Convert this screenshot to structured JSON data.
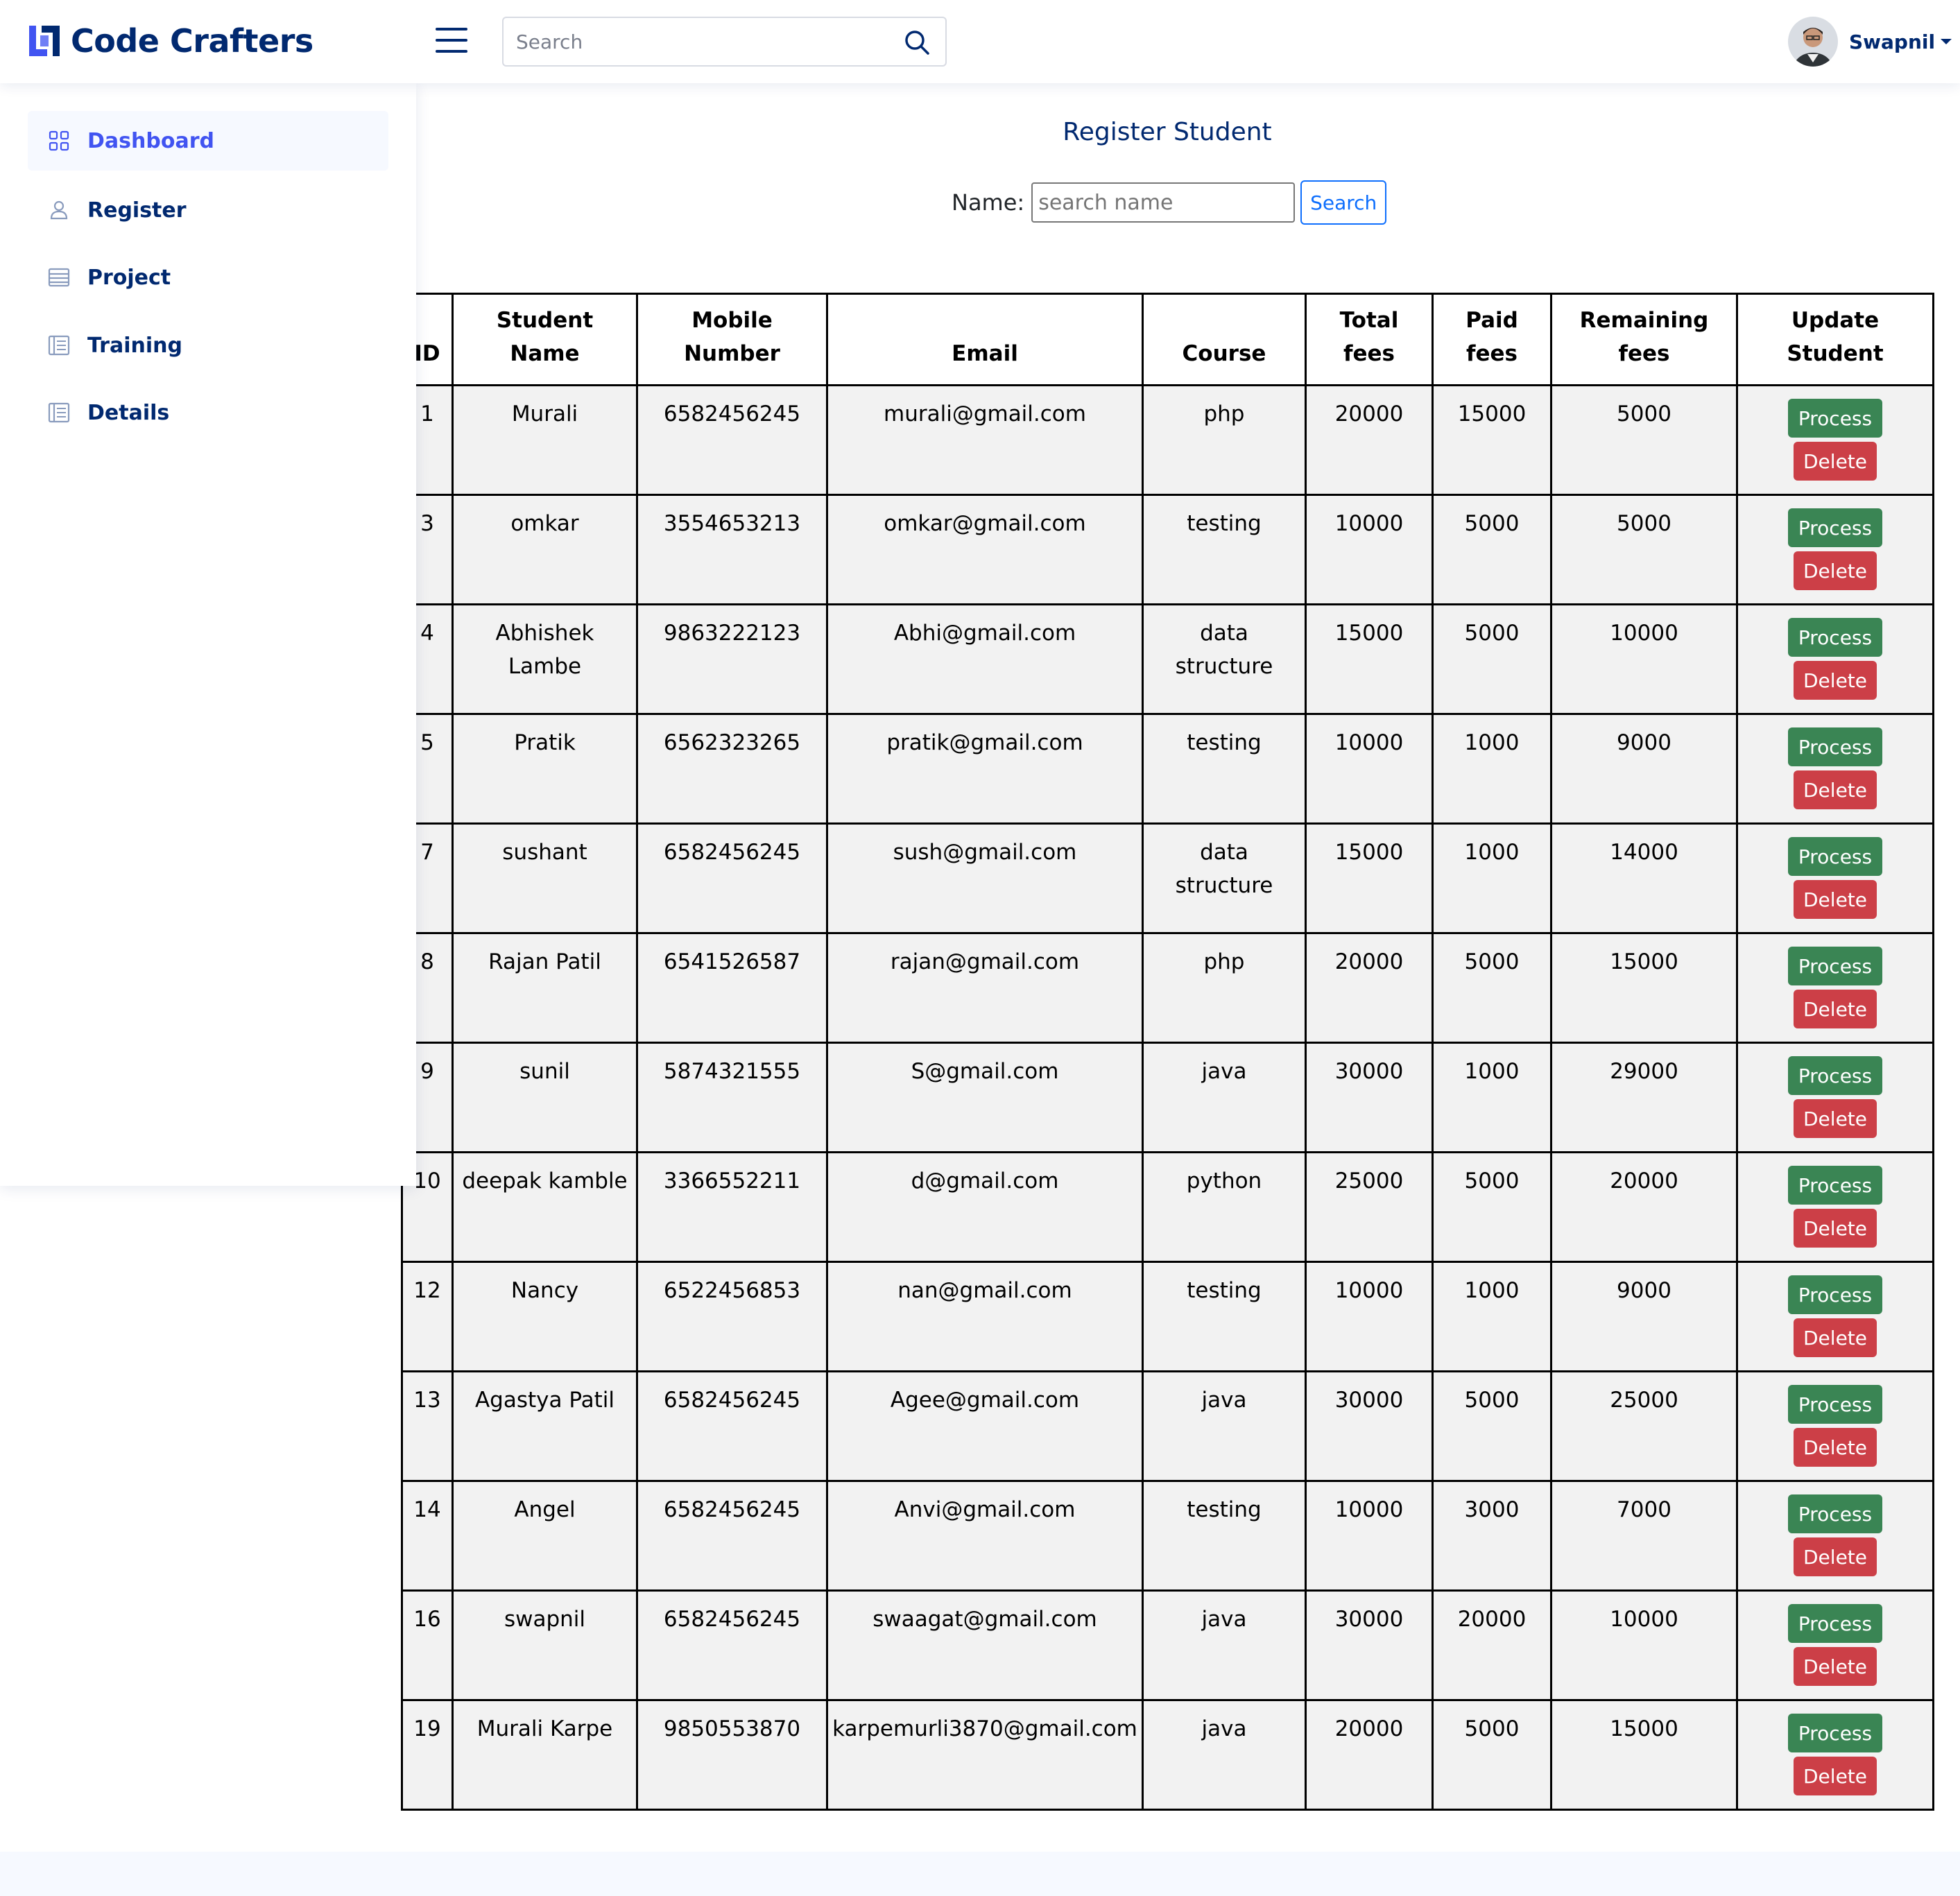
{
  "header": {
    "brand": "Code Crafters",
    "search_placeholder": "Search",
    "user_name": "Swapnil",
    "icons": {
      "logo": "logo-icon",
      "menu": "hamburger-icon",
      "search": "search-icon",
      "caret": "caret-down-icon"
    }
  },
  "sidebar": {
    "items": [
      {
        "label": "Dashboard",
        "icon": "grid-icon",
        "active": true
      },
      {
        "label": "Register",
        "icon": "person-icon",
        "active": false
      },
      {
        "label": "Project",
        "icon": "layout-icon",
        "active": false
      },
      {
        "label": "Training",
        "icon": "table-icon",
        "active": false
      },
      {
        "label": "Details",
        "icon": "table-icon",
        "active": false
      }
    ]
  },
  "main": {
    "title": "Register Student",
    "filter": {
      "label": "Name:",
      "placeholder": "search name",
      "button": "Search"
    },
    "table": {
      "headers": {
        "id": "ID",
        "name": "Student Name",
        "mobile": "Mobile Number",
        "email": "Email",
        "course": "Course",
        "total": "Total fees",
        "paid": "Paid fees",
        "remaining": "Remaining fees",
        "update": "Update Student"
      },
      "process_label": "Process",
      "delete_label": "Delete",
      "rows": [
        {
          "id": "1",
          "name": "Murali",
          "mobile": "6582456245",
          "email": "murali@gmail.com",
          "course": "php",
          "total": "20000",
          "paid": "15000",
          "remaining": "5000"
        },
        {
          "id": "3",
          "name": "omkar",
          "mobile": "3554653213",
          "email": "omkar@gmail.com",
          "course": "testing",
          "total": "10000",
          "paid": "5000",
          "remaining": "5000"
        },
        {
          "id": "4",
          "name": "Abhishek Lambe",
          "mobile": "9863222123",
          "email": "Abhi@gmail.com",
          "course": "data structure",
          "total": "15000",
          "paid": "5000",
          "remaining": "10000"
        },
        {
          "id": "5",
          "name": "Pratik",
          "mobile": "6562323265",
          "email": "pratik@gmail.com",
          "course": "testing",
          "total": "10000",
          "paid": "1000",
          "remaining": "9000"
        },
        {
          "id": "7",
          "name": "sushant",
          "mobile": "6582456245",
          "email": "sush@gmail.com",
          "course": "data structure",
          "total": "15000",
          "paid": "1000",
          "remaining": "14000"
        },
        {
          "id": "8",
          "name": "Rajan Patil",
          "mobile": "6541526587",
          "email": "rajan@gmail.com",
          "course": "php",
          "total": "20000",
          "paid": "5000",
          "remaining": "15000"
        },
        {
          "id": "9",
          "name": "sunil",
          "mobile": "5874321555",
          "email": "S@gmail.com",
          "course": "java",
          "total": "30000",
          "paid": "1000",
          "remaining": "29000"
        },
        {
          "id": "10",
          "name": "deepak kamble",
          "mobile": "3366552211",
          "email": "d@gmail.com",
          "course": "python",
          "total": "25000",
          "paid": "5000",
          "remaining": "20000"
        },
        {
          "id": "12",
          "name": "Nancy",
          "mobile": "6522456853",
          "email": "nan@gmail.com",
          "course": "testing",
          "total": "10000",
          "paid": "1000",
          "remaining": "9000"
        },
        {
          "id": "13",
          "name": "Agastya Patil",
          "mobile": "6582456245",
          "email": "Agee@gmail.com",
          "course": "java",
          "total": "30000",
          "paid": "5000",
          "remaining": "25000"
        },
        {
          "id": "14",
          "name": "Angel",
          "mobile": "6582456245",
          "email": "Anvi@gmail.com",
          "course": "testing",
          "total": "10000",
          "paid": "3000",
          "remaining": "7000"
        },
        {
          "id": "16",
          "name": "swapnil",
          "mobile": "6582456245",
          "email": "swaagat@gmail.com",
          "course": "java",
          "total": "30000",
          "paid": "20000",
          "remaining": "10000"
        },
        {
          "id": "19",
          "name": "Murali Karpe",
          "mobile": "9850553870",
          "email": "karpemurli3870@gmail.com",
          "course": "java",
          "total": "20000",
          "paid": "5000",
          "remaining": "15000"
        }
      ]
    }
  },
  "colors": {
    "brand": "#012970",
    "accent": "#4154f1",
    "process": "#3a8554",
    "delete": "#cc3f47",
    "search_button": "#0d6efd"
  }
}
